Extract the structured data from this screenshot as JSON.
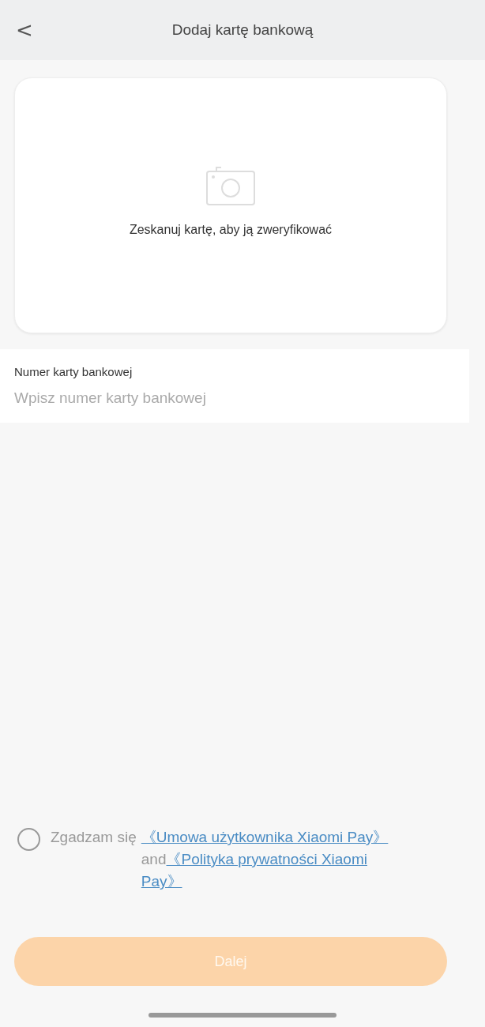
{
  "header": {
    "back": "<",
    "title": "Dodaj kartę bankową"
  },
  "scan_card": {
    "text": "Zeskanuj kartę, aby ją zweryfikować"
  },
  "card_number": {
    "label": "Numer karty bankowej",
    "placeholder": "Wpisz numer karty bankowej"
  },
  "agreement": {
    "checked": false,
    "prefix": "Zgadzam się",
    "link_1": "《Umowa użytkownika Xiaomi Pay》",
    "joiner": "and",
    "link_2": "《Polityka prywatności Xiaomi Pay》"
  },
  "next_button": {
    "label": "Dalej",
    "disabled": true
  }
}
